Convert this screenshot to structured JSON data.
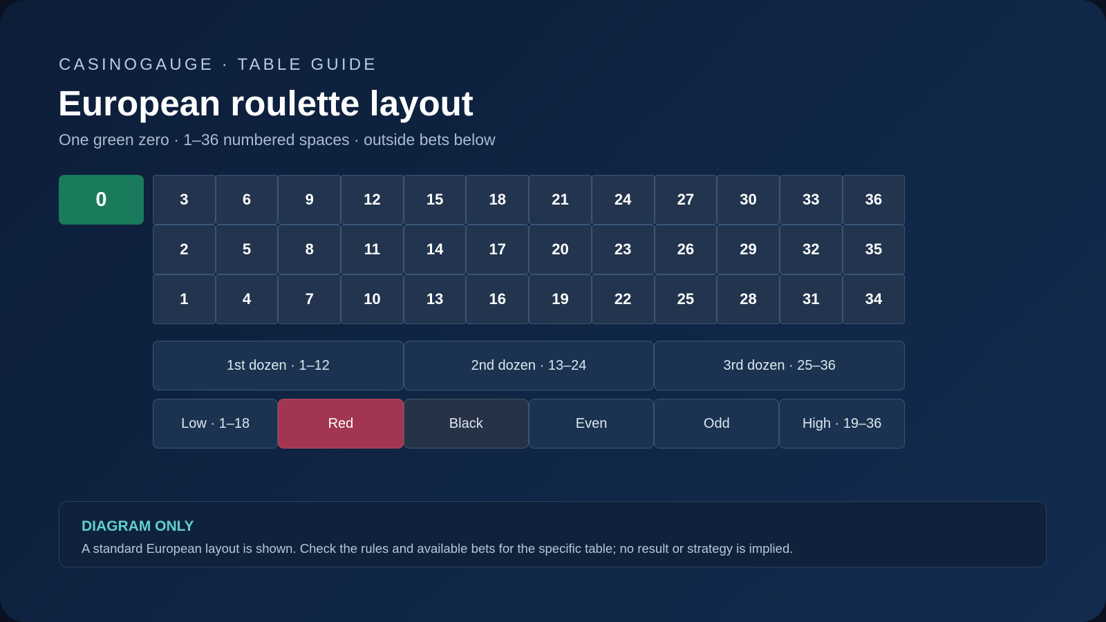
{
  "header": {
    "eyebrow": "CASINOGAUGE · TABLE GUIDE",
    "title": "European roulette layout",
    "subtitle": "One green zero · 1–36 numbered spaces · outside bets below"
  },
  "table": {
    "zero": "0",
    "rows": [
      [
        "3",
        "6",
        "9",
        "12",
        "15",
        "18",
        "21",
        "24",
        "27",
        "30",
        "33",
        "36"
      ],
      [
        "2",
        "5",
        "8",
        "11",
        "14",
        "17",
        "20",
        "23",
        "26",
        "29",
        "32",
        "35"
      ],
      [
        "1",
        "4",
        "7",
        "10",
        "13",
        "16",
        "19",
        "22",
        "25",
        "28",
        "31",
        "34"
      ]
    ],
    "dozens": [
      "1st dozen · 1–12",
      "2nd dozen · 13–24",
      "3rd dozen · 25–36"
    ],
    "even_money": [
      "Low · 1–18",
      "Red",
      "Black",
      "Even",
      "Odd",
      "High · 19–36"
    ]
  },
  "colors": {
    "zero_green": "#1a7a5c",
    "red_bet": "#a23650",
    "black_bet": "#263346",
    "accent": "#5fd0cc"
  },
  "notice": {
    "title": "DIAGRAM ONLY",
    "text": "A standard European layout is shown. Check the rules and available bets for the specific table; no result or strategy is implied."
  }
}
